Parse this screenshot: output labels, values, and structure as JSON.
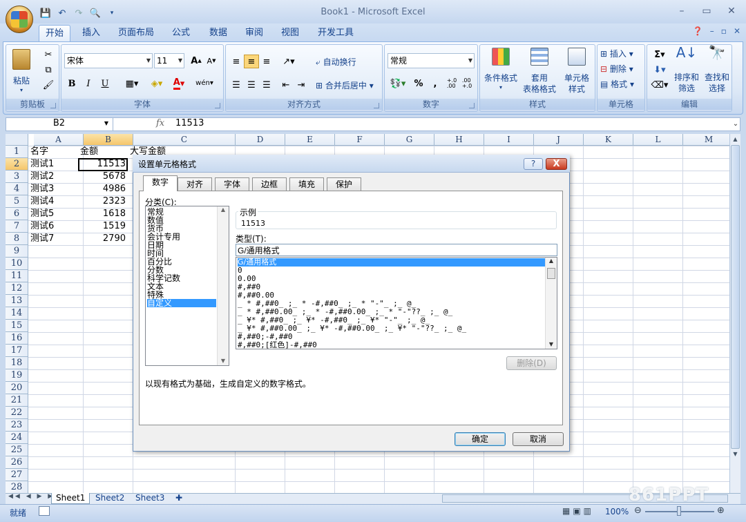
{
  "window": {
    "title": "Book1 - Microsoft Excel"
  },
  "ribbon_tabs": [
    "开始",
    "插入",
    "页面布局",
    "公式",
    "数据",
    "审阅",
    "视图",
    "开发工具"
  ],
  "ribbon": {
    "clipboard": {
      "label": "剪贴板",
      "paste": "粘贴"
    },
    "font": {
      "label": "字体",
      "name": "宋体",
      "size": "11",
      "bold": "B",
      "italic": "I",
      "underline": "U",
      "grow": "A",
      "shrink": "A",
      "color_a": "A",
      "wen": "wén"
    },
    "alignment": {
      "label": "对齐方式",
      "wrap": "自动换行",
      "merge": "合并后居中"
    },
    "number": {
      "label": "数字",
      "format": "常规",
      "percent": "%",
      "comma": ",",
      "inc": "+.0\n.00",
      "dec": ".00\n+.0"
    },
    "styles": {
      "label": "样式",
      "cond": "条件格式",
      "table1": "套用",
      "table2": "表格格式",
      "cell1": "单元格",
      "cell2": "样式"
    },
    "cells": {
      "label": "单元格",
      "insert": "插入",
      "delete": "删除",
      "format": "格式"
    },
    "editing": {
      "label": "编辑",
      "sum": "Σ",
      "sort1": "排序和",
      "sort2": "筛选",
      "find1": "查找和",
      "find2": "选择"
    }
  },
  "formula_bar": {
    "name_box": "B2",
    "fx": "fx",
    "value": "11513"
  },
  "columns": [
    "A",
    "B",
    "C",
    "D",
    "E",
    "F",
    "G",
    "H",
    "I",
    "J",
    "K",
    "L",
    "M"
  ],
  "rows": [
    "1",
    "2",
    "3",
    "4",
    "5",
    "6",
    "7",
    "8",
    "9",
    "10",
    "11",
    "12",
    "13",
    "14",
    "15",
    "16",
    "17",
    "18",
    "19",
    "20",
    "21",
    "22",
    "23",
    "24",
    "25",
    "26",
    "27",
    "28"
  ],
  "cells": {
    "A": [
      "名字",
      "测试1",
      "测试2",
      "测试3",
      "测试4",
      "测试5",
      "测试6",
      "测试7"
    ],
    "B": [
      "金额",
      "11513",
      "5678",
      "4986",
      "2323",
      "1618",
      "1519",
      "2790"
    ],
    "C1": "大写金额"
  },
  "sheets": [
    "Sheet1",
    "Sheet2",
    "Sheet3"
  ],
  "status": {
    "ready": "就绪",
    "zoom": "100%"
  },
  "dialog": {
    "title": "设置单元格格式",
    "help": "?",
    "close": "X",
    "tabs": [
      "数字",
      "对齐",
      "字体",
      "边框",
      "填充",
      "保护"
    ],
    "category_label": "分类(C):",
    "categories": [
      "常规",
      "数值",
      "货币",
      "会计专用",
      "日期",
      "时间",
      "百分比",
      "分数",
      "科学记数",
      "文本",
      "特殊",
      "自定义"
    ],
    "sample_label": "示例",
    "sample_value": "11513",
    "type_label": "类型(T):",
    "type_value": "G/通用格式",
    "types": [
      "G/通用格式",
      "0",
      "0.00",
      "#,##0",
      "#,##0.00",
      "_ * #,##0_ ;_ * -#,##0_ ;_ * \"-\"_ ;_ @_",
      "_ * #,##0.00_ ;_ * -#,##0.00_ ;_ * \"-\"??_ ;_ @_",
      "_ ¥* #,##0_ ;_ ¥* -#,##0_ ;_ ¥* \"-\"_ ;_ @_",
      "_ ¥* #,##0.00_ ;_ ¥* -#,##0.00_ ;_ ¥* \"-\"??_ ;_ @_",
      "#,##0;-#,##0",
      "#,##0;[红色]-#,##0"
    ],
    "delete_btn": "删除(D)",
    "description": "以现有格式为基础，生成自定义的数字格式。",
    "ok": "确定",
    "cancel": "取消"
  },
  "watermark": "861PPT",
  "colors": {
    "accent": "#3399ff",
    "ribbon": "#dbe7f6",
    "selected_header": "#f5c66b"
  }
}
